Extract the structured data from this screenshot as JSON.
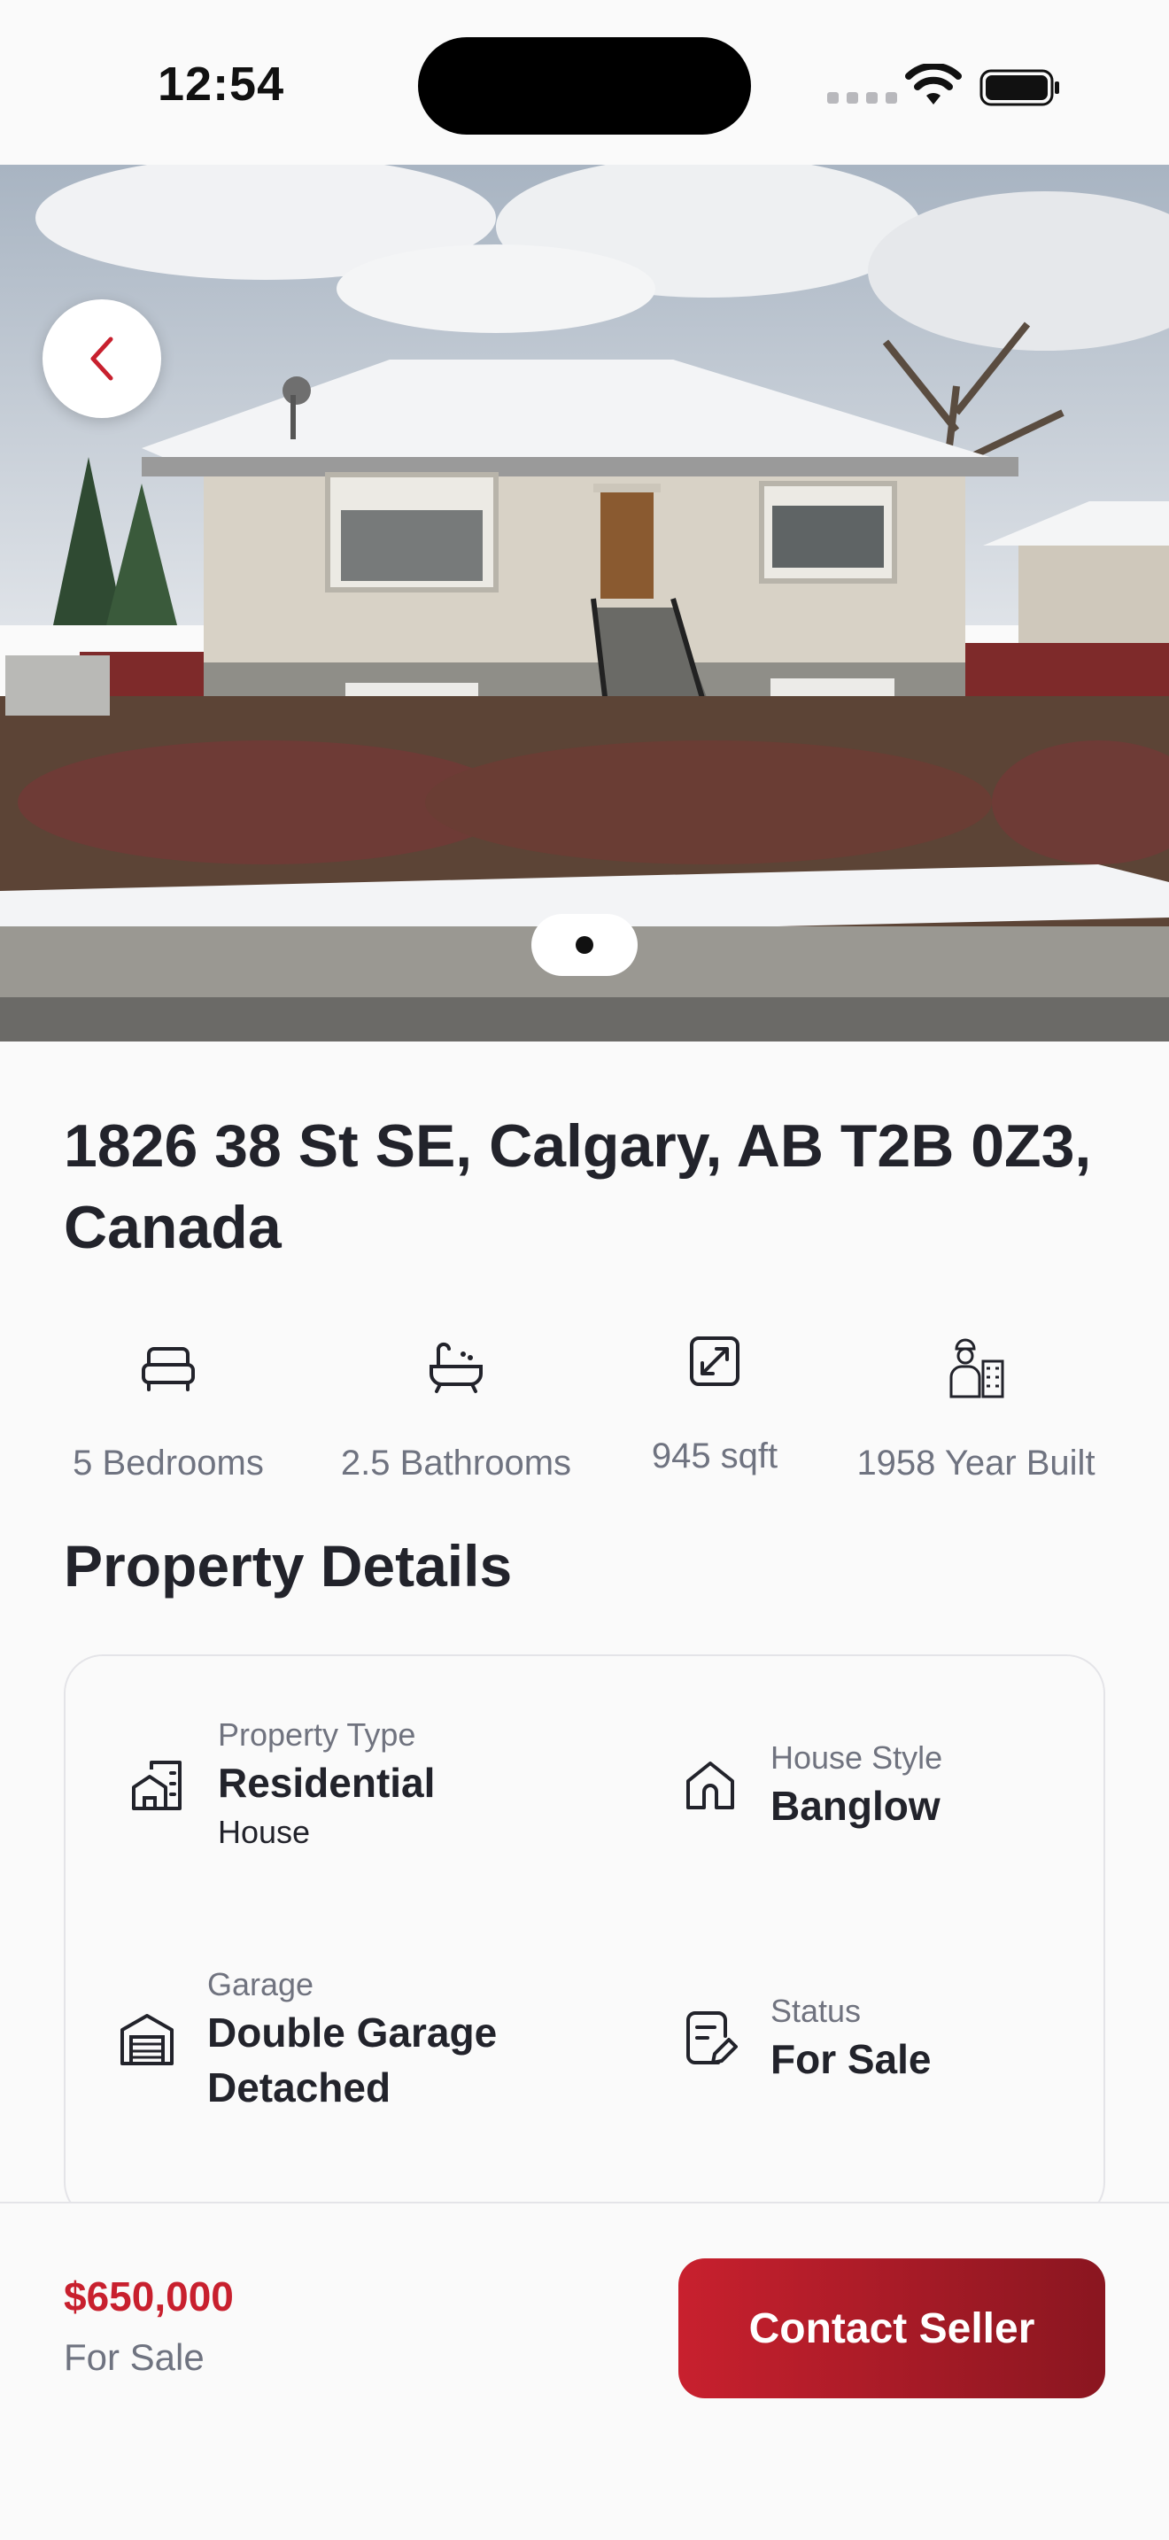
{
  "status_bar": {
    "time": "12:54"
  },
  "hero": {
    "back_icon": "chevron-left-icon",
    "page_index": 1
  },
  "listing": {
    "address": "1826 38 St SE, Calgary, AB T2B 0Z3, Canada",
    "stats": [
      {
        "icon": "bed-icon",
        "label": "5 Bedrooms"
      },
      {
        "icon": "bathtub-icon",
        "label": "2.5 Bathrooms"
      },
      {
        "icon": "expand-icon",
        "label": "945 sqft"
      },
      {
        "icon": "builder-icon",
        "label": "1958 Year Built"
      }
    ]
  },
  "details": {
    "title": "Property Details",
    "property_type": {
      "label": "Property Type",
      "value": "Residential",
      "sub": "House",
      "icon": "buildings-icon"
    },
    "house_style": {
      "label": "House Style",
      "value": "Banglow",
      "icon": "house-icon"
    },
    "garage": {
      "label": "Garage",
      "value": "Double Garage Detached",
      "icon": "garage-icon"
    },
    "status": {
      "label": "Status",
      "value": "For Sale",
      "icon": "note-edit-icon"
    }
  },
  "footer": {
    "price": "$650,000",
    "price_status": "For Sale",
    "contact_label": "Contact Seller"
  },
  "colors": {
    "accent": "#c8202e",
    "accent_dark": "#8a1620",
    "text": "#22232b",
    "muted": "#6f7380"
  }
}
